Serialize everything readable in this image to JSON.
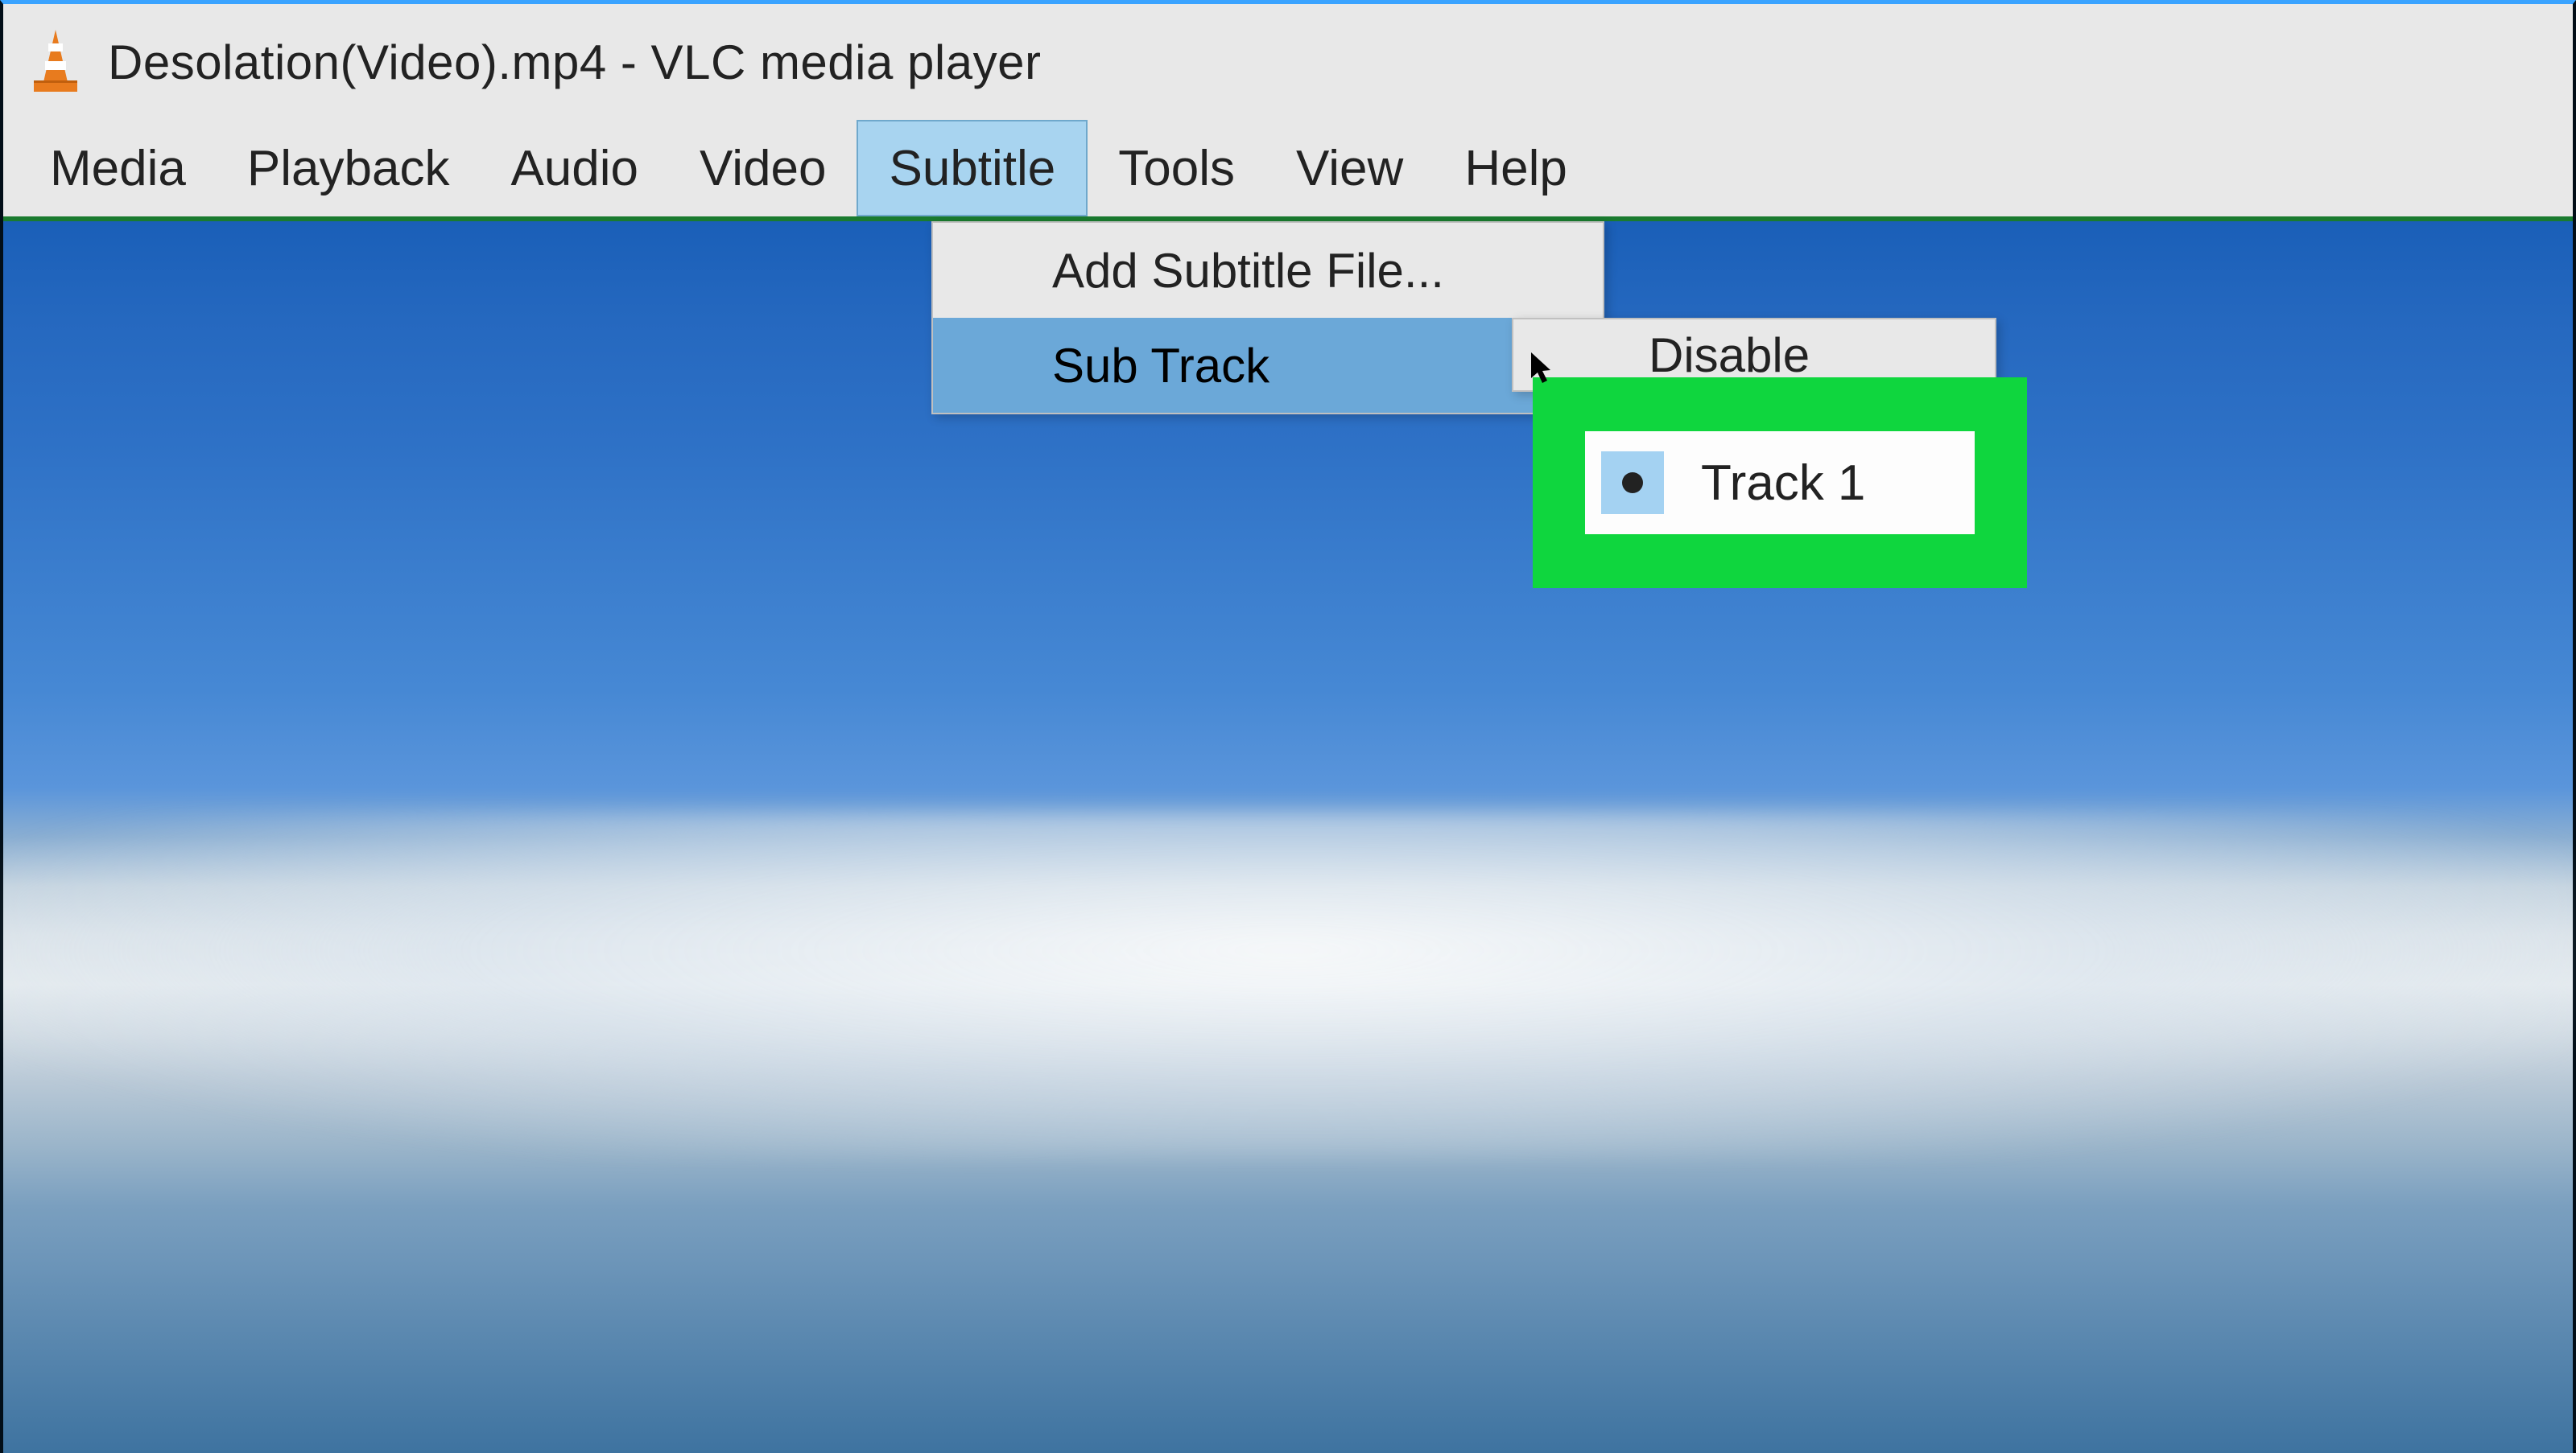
{
  "titlebar": {
    "title": "Desolation(Video).mp4 - VLC media player"
  },
  "menubar": {
    "items": [
      {
        "label": "Media"
      },
      {
        "label": "Playback"
      },
      {
        "label": "Audio"
      },
      {
        "label": "Video"
      },
      {
        "label": "Subtitle",
        "active": true
      },
      {
        "label": "Tools"
      },
      {
        "label": "View"
      },
      {
        "label": "Help"
      }
    ]
  },
  "dropdown": {
    "items": [
      {
        "label": "Add Subtitle File..."
      },
      {
        "label": "Sub Track",
        "hover": true,
        "submenu": true
      }
    ]
  },
  "submenu": {
    "items": [
      {
        "label": "Disable",
        "partial": true
      },
      {
        "label": "Track 1",
        "selected": true
      }
    ]
  },
  "highlight": {
    "track_label": "Track 1"
  }
}
